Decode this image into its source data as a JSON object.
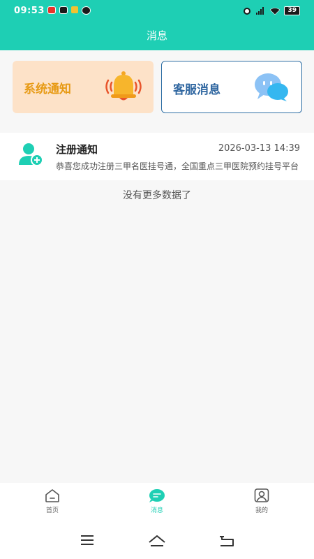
{
  "status_bar": {
    "time": "09:53",
    "battery": "39"
  },
  "header": {
    "title": "消息"
  },
  "cards": [
    {
      "label": "系统通知",
      "icon": "bell-icon"
    },
    {
      "label": "客服消息",
      "icon": "chat-bubbles-icon"
    }
  ],
  "messages": [
    {
      "title": "注册通知",
      "time": "2026-03-13 14:39",
      "preview": "恭喜您成功注册三甲名医挂号通，全国重点三甲医院预约挂号平台",
      "icon": "user-add-icon"
    }
  ],
  "list_footer": "没有更多数据了",
  "tabbar": {
    "items": [
      {
        "label": "首页",
        "icon": "home-icon"
      },
      {
        "label": "消息",
        "icon": "message-icon",
        "active": true
      },
      {
        "label": "我的",
        "icon": "profile-icon"
      }
    ]
  },
  "colors": {
    "primary": "#1ecfb4",
    "system_card_bg": "#fde2c8",
    "system_card_text": "#e79a14",
    "service_card_text": "#2f66a0",
    "service_card_border": "#2f6fa5"
  }
}
